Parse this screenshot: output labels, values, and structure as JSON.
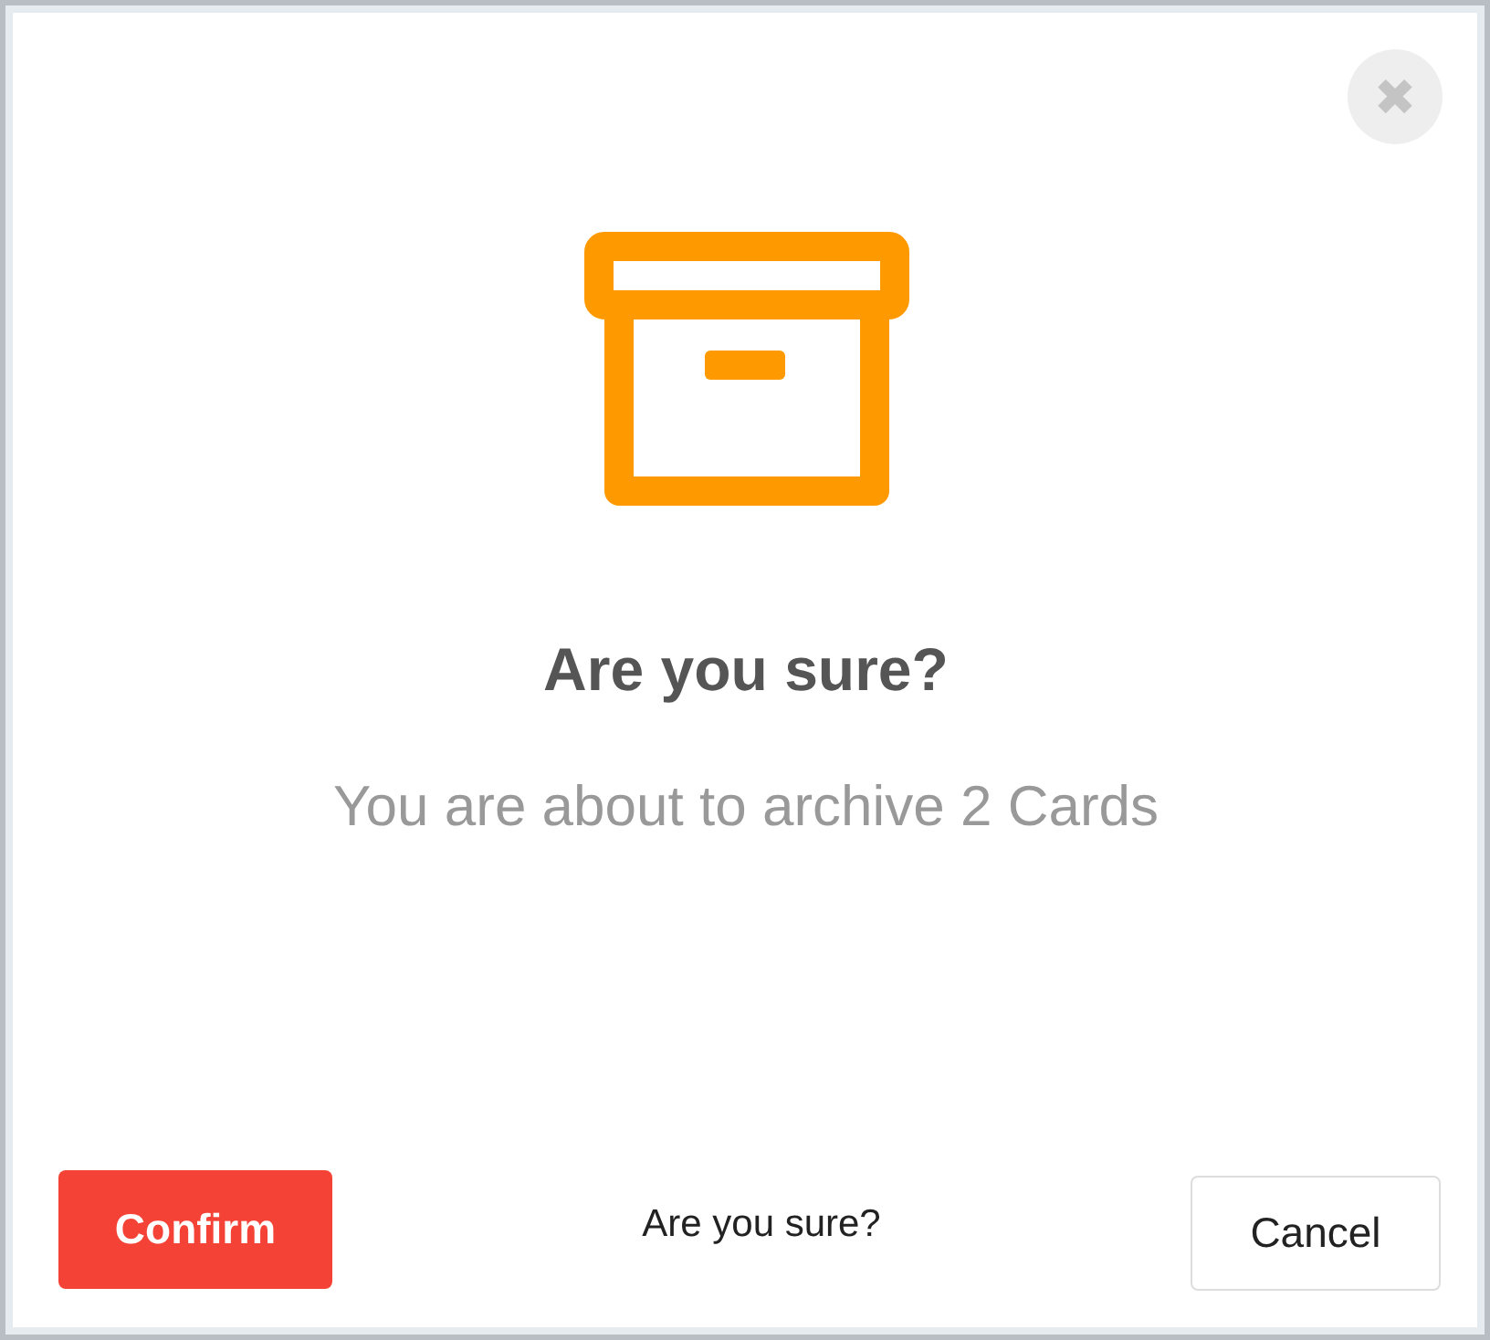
{
  "dialog": {
    "close": "✖",
    "title": "Are you sure?",
    "message": "You are about to archive 2 Cards"
  },
  "footer": {
    "confirm": "Confirm",
    "note": "Are you sure?",
    "cancel": "Cancel"
  }
}
